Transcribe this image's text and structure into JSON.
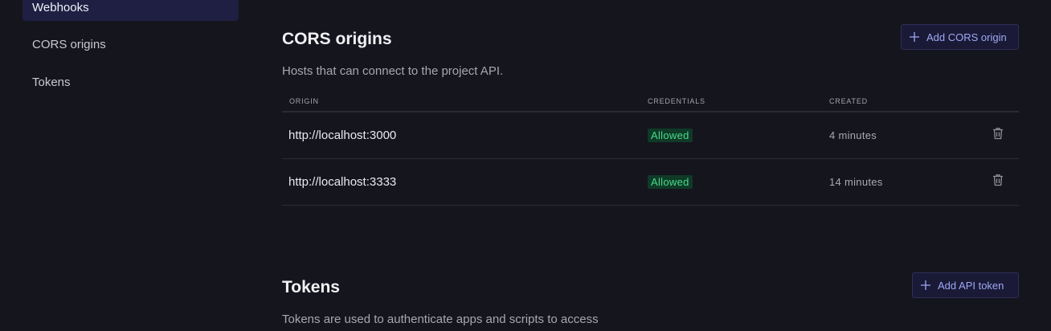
{
  "sidebar": {
    "items": [
      {
        "label": "Webhooks",
        "active": true
      },
      {
        "label": "CORS origins",
        "active": false
      },
      {
        "label": "Tokens",
        "active": false
      }
    ]
  },
  "cors": {
    "title": "CORS origins",
    "description": "Hosts that can connect to the project API.",
    "add_button_label": "Add CORS origin",
    "columns": [
      "ORIGIN",
      "CREDENTIALS",
      "CREATED"
    ],
    "rows": [
      {
        "origin": "http://localhost:3000",
        "credentials": "Allowed",
        "created": "4 minutes"
      },
      {
        "origin": "http://localhost:3333",
        "credentials": "Allowed",
        "created": "14 minutes"
      }
    ]
  },
  "tokens": {
    "title": "Tokens",
    "description": "Tokens are used to authenticate apps and scripts to access",
    "add_button_label": "Add API token"
  },
  "icons": {
    "plus": "plus-icon",
    "delete": "trash-icon"
  },
  "colors": {
    "background": "#15151d",
    "accent": "#9ea8f5",
    "badge_bg": "#0f3a27",
    "badge_text": "#4ad98b",
    "sidebar_active": "#1f1f44"
  }
}
